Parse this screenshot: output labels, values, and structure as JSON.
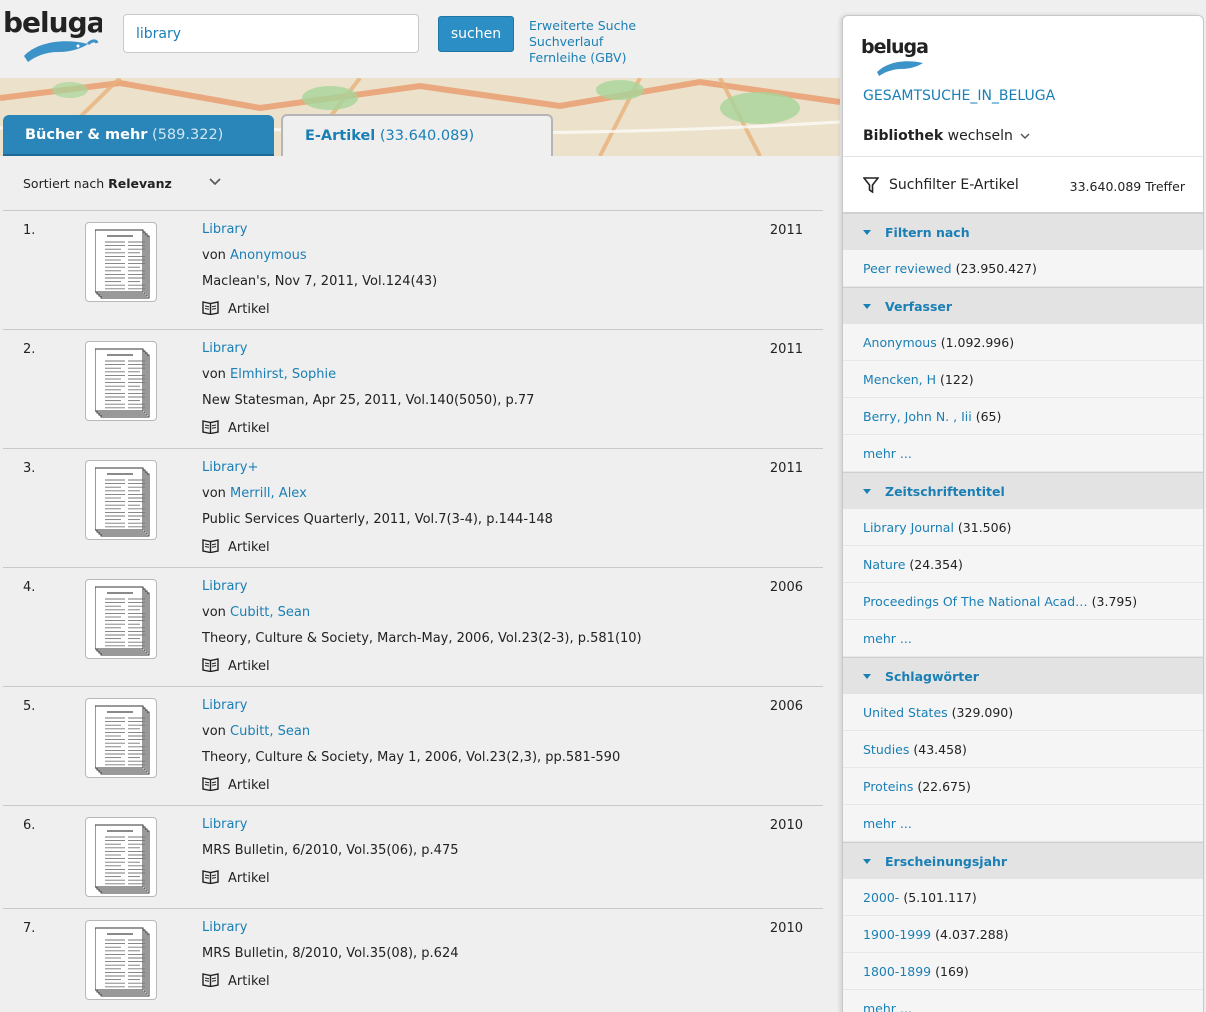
{
  "header": {
    "search_value": "library",
    "search_button": "suchen",
    "links": [
      "Erweiterte Suche",
      "Suchverlauf",
      "Fernleihe (GBV)"
    ]
  },
  "tabs": [
    {
      "label": "Bücher & mehr",
      "count": "(589.322)",
      "active": false
    },
    {
      "label": "E-Artikel",
      "count": "(33.640.089)",
      "active": true
    }
  ],
  "sort": {
    "label": "Sortiert nach",
    "value": "Relevanz"
  },
  "results": [
    {
      "num": "1.",
      "title": "Library",
      "by": "von",
      "author": "Anonymous",
      "source": "Maclean's, Nov 7, 2011, Vol.124(43)",
      "type": "Artikel",
      "year": "2011"
    },
    {
      "num": "2.",
      "title": "Library",
      "by": "von",
      "author": "Elmhirst, Sophie",
      "source": "New Statesman, Apr 25, 2011, Vol.140(5050), p.77",
      "type": "Artikel",
      "year": "2011"
    },
    {
      "num": "3.",
      "title": "Library+",
      "by": "von",
      "author": "Merrill, Alex",
      "source": "Public Services Quarterly, 2011, Vol.7(3-4), p.144-148",
      "type": "Artikel",
      "year": "2011"
    },
    {
      "num": "4.",
      "title": "Library",
      "by": "von",
      "author": "Cubitt, Sean",
      "source": "Theory, Culture & Society, March-May, 2006, Vol.23(2-3), p.581(10)",
      "type": "Artikel",
      "year": "2006"
    },
    {
      "num": "5.",
      "title": "Library",
      "by": "von",
      "author": "Cubitt, Sean",
      "source": "Theory, Culture & Society, May 1, 2006, Vol.23(2,3), pp.581-590",
      "type": "Artikel",
      "year": "2006"
    },
    {
      "num": "6.",
      "title": "Library",
      "by": "",
      "author": "",
      "source": "MRS Bulletin, 6/2010, Vol.35(06), p.475",
      "type": "Artikel",
      "year": "2010"
    },
    {
      "num": "7.",
      "title": "Library",
      "by": "",
      "author": "",
      "source": "MRS Bulletin, 8/2010, Vol.35(08), p.624",
      "type": "Artikel",
      "year": "2010"
    }
  ],
  "sidebar": {
    "library_name": "GESAMTSUCHE_IN_BELUGA",
    "switch_bold": "Bibliothek",
    "switch_rest": "wechseln",
    "filter_title": "Suchfilter E-Artikel",
    "hits": "33.640.089 Treffer",
    "facets": [
      {
        "title": "Filtern nach",
        "items": [
          {
            "name": "Peer reviewed",
            "count": "(23.950.427)"
          }
        ]
      },
      {
        "title": "Verfasser",
        "items": [
          {
            "name": "Anonymous",
            "count": "(1.092.996)"
          },
          {
            "name": "Mencken, H",
            "count": "(122)"
          },
          {
            "name": "Berry, John N. , Iii",
            "count": "(65)"
          },
          {
            "name": "mehr ...",
            "count": ""
          }
        ]
      },
      {
        "title": "Zeitschriftentitel",
        "items": [
          {
            "name": "Library Journal",
            "count": "(31.506)"
          },
          {
            "name": "Nature",
            "count": "(24.354)"
          },
          {
            "name": "Proceedings Of The National Acad…",
            "count": "(3.795)"
          },
          {
            "name": "mehr ...",
            "count": ""
          }
        ]
      },
      {
        "title": "Schlagwörter",
        "items": [
          {
            "name": "United States",
            "count": "(329.090)"
          },
          {
            "name": "Studies",
            "count": "(43.458)"
          },
          {
            "name": "Proteins",
            "count": "(22.675)"
          },
          {
            "name": "mehr ...",
            "count": ""
          }
        ]
      },
      {
        "title": "Erscheinungsjahr",
        "items": [
          {
            "name": "2000-",
            "count": "(5.101.117)"
          },
          {
            "name": "1900-1999",
            "count": "(4.037.288)"
          },
          {
            "name": "1800-1899",
            "count": "(169)"
          },
          {
            "name": "mehr ...",
            "count": ""
          }
        ]
      }
    ]
  }
}
